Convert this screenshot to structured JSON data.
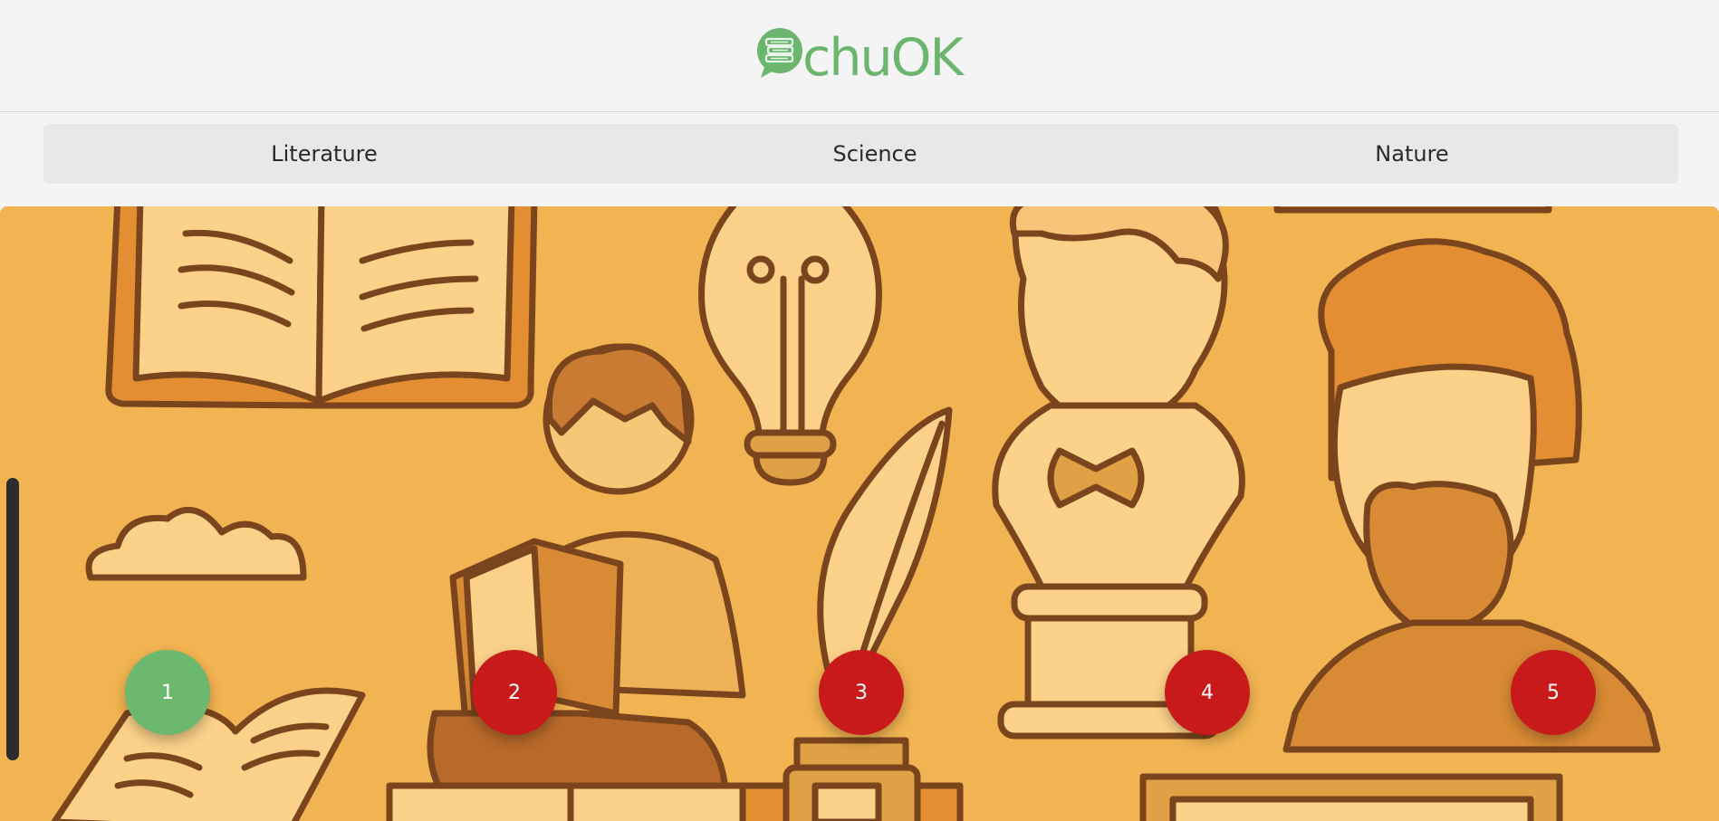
{
  "app": {
    "logo_text": "chuOK",
    "logo_icon": "book-stack-chat-bubble-icon",
    "brand_color": "#6bb56e"
  },
  "tabs": [
    {
      "label": "Literature"
    },
    {
      "label": "Science"
    },
    {
      "label": "Nature"
    }
  ],
  "stage": {
    "background_color": "#f2b452",
    "illustration": "books-lightbulb-reading-boy-quill-busts-scene"
  },
  "markers": [
    {
      "label": "1",
      "status": "completed",
      "color": "#6cb86e"
    },
    {
      "label": "2",
      "status": "locked",
      "color": "#c81a1a"
    },
    {
      "label": "3",
      "status": "locked",
      "color": "#c81a1a"
    },
    {
      "label": "4",
      "status": "locked",
      "color": "#c81a1a"
    },
    {
      "label": "5",
      "status": "locked",
      "color": "#c81a1a"
    }
  ]
}
